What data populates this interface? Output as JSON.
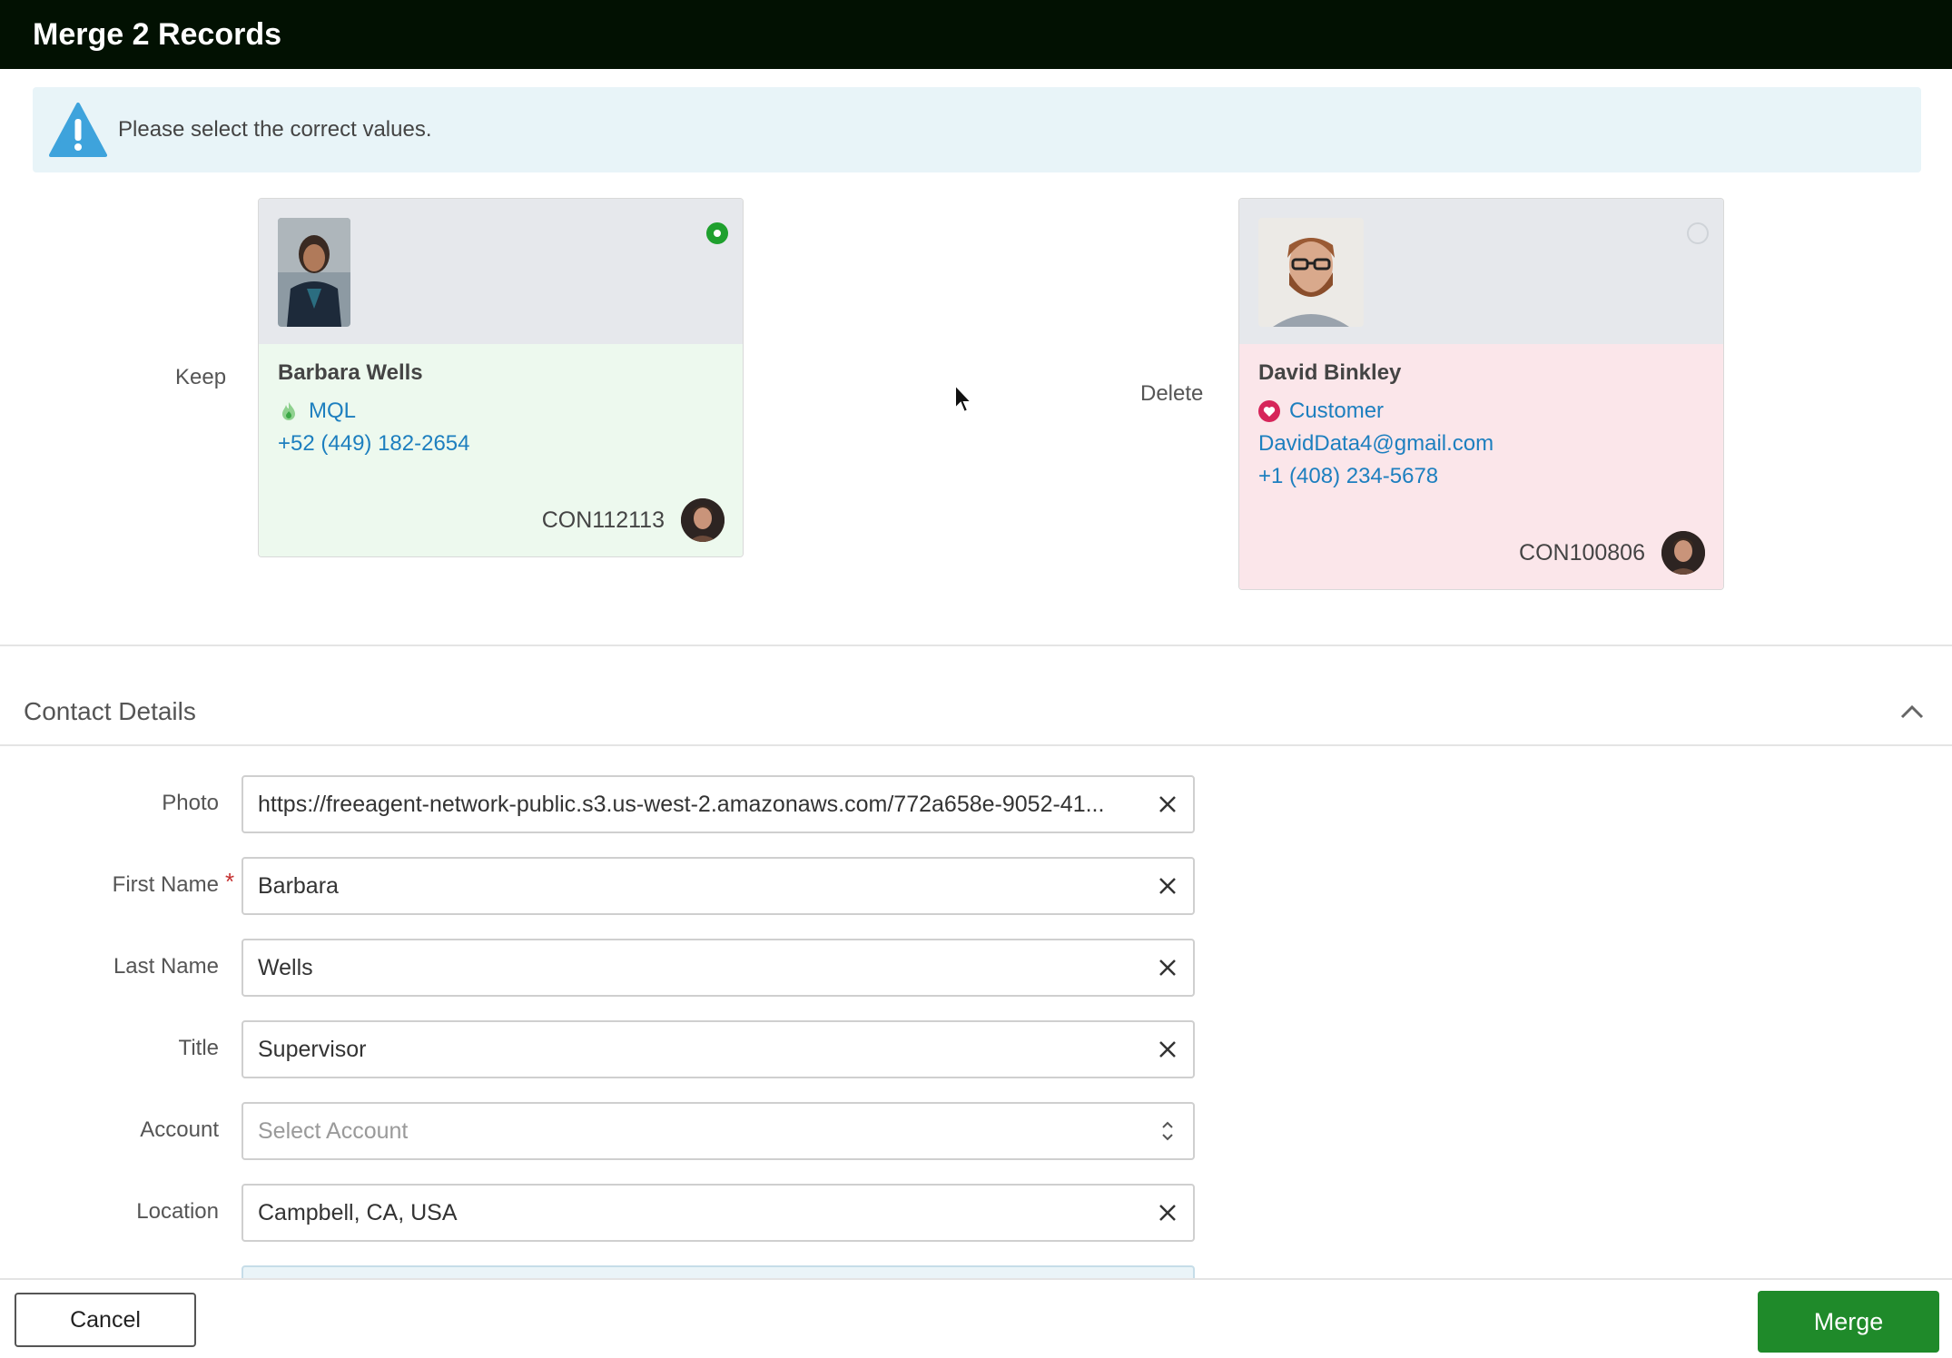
{
  "window": {
    "title": "Merge 2 Records"
  },
  "alert": {
    "icon": "warning-icon",
    "message": "Please select the correct values."
  },
  "records": {
    "keep": {
      "side_label": "Keep",
      "name": "Barbara Wells",
      "status": "MQL",
      "phone": "+52 (449) 182-2654",
      "ref_id": "CON112113",
      "selected": true
    },
    "delete": {
      "side_label": "Delete",
      "name": "David Binkley",
      "status": "Customer",
      "email": "DavidData4@gmail.com",
      "phone": "+1 (408) 234-5678",
      "ref_id": "CON100806",
      "selected": false
    }
  },
  "section": {
    "title": "Contact Details"
  },
  "fields": {
    "photo": {
      "label": "Photo",
      "value": "https://freeagent-network-public.s3.us-west-2.amazonaws.com/772a658e-9052-41..."
    },
    "first_name": {
      "label": "First Name",
      "required_mark": "*",
      "value": "Barbara"
    },
    "last_name": {
      "label": "Last Name",
      "value": "Wells"
    },
    "title": {
      "label": "Title",
      "value": "Supervisor"
    },
    "account": {
      "label": "Account",
      "placeholder": "Select Account"
    },
    "location": {
      "label": "Location",
      "value": "Campbell, CA, USA"
    }
  },
  "footer": {
    "cancel_label": "Cancel",
    "merge_label": "Merge"
  },
  "colors": {
    "titlebar": "#021102",
    "accent_green": "#1f8a2a",
    "link_blue": "#1d7fbf",
    "keep_bg": "#edf9ee",
    "delete_bg": "#fbe6ea"
  }
}
